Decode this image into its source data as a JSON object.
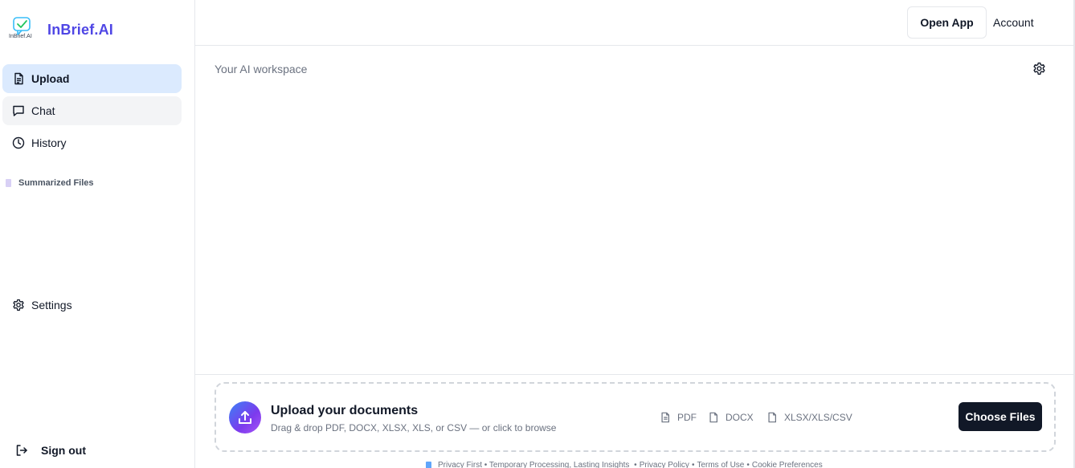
{
  "brand": {
    "name": "InBrief.AI",
    "logo_caption": "InBrief.AI",
    "accent": "#4f46e5"
  },
  "sidebar": {
    "items": [
      {
        "label": "Upload",
        "icon": "file-icon",
        "active": true
      },
      {
        "label": "Chat",
        "icon": "chat-bubble-icon",
        "active": false
      },
      {
        "label": "History",
        "icon": "clock-icon",
        "active": false
      }
    ],
    "section_label": "Summarized Files",
    "settings_label": "Settings",
    "signout_label": "Sign out"
  },
  "header": {
    "open_app_label": "Open App",
    "account_label": "Account"
  },
  "workspace": {
    "label": "Your AI workspace"
  },
  "upload": {
    "title": "Upload your documents",
    "subtitle": "Drag & drop PDF, DOCX, XLSX, XLS, or CSV — or click to browse",
    "file_types": [
      "PDF",
      "DOCX",
      "XLSX/XLS/CSV"
    ],
    "choose_label": "Choose Files"
  },
  "footer": {
    "tagline": "Privacy First • Temporary Processing, Lasting Insights",
    "links": [
      "Privacy Policy",
      "Terms of Use",
      "Cookie Preferences"
    ]
  },
  "colors": {
    "active_nav_bg": "#dbeafe",
    "hover_nav_bg": "#f3f4f6",
    "primary_button": "#111827"
  }
}
